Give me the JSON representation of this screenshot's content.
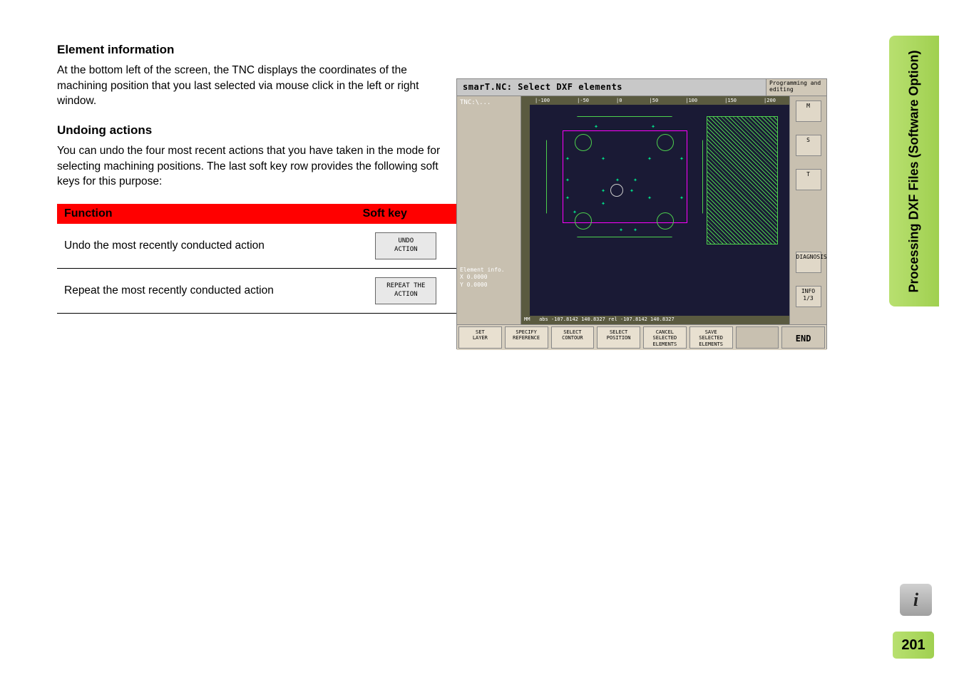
{
  "side_tab": "Processing DXF Files (Software Option)",
  "section1": {
    "heading": "Element information",
    "body": "At the bottom left of the screen, the TNC displays the coordinates of the machining position that you last selected via mouse click in the left or right window."
  },
  "section2": {
    "heading": "Undoing actions",
    "body": "You can undo the four most recent actions that you have taken in the mode for selecting machining positions. The last soft key row provides the following soft keys for this purpose:"
  },
  "table": {
    "head_func": "Function",
    "head_soft": "Soft key",
    "rows": [
      {
        "desc": "Undo the most recently conducted action",
        "key": "UNDO\nACTION"
      },
      {
        "desc": "Repeat the most recently conducted action",
        "key": "REPEAT THE\nACTION"
      }
    ]
  },
  "tnc": {
    "title": "smarT.NC: Select DXF elements",
    "mode": "Programming\nand editing",
    "path": "TNC:\\...",
    "ruler_ticks": [
      "|-100",
      "|-50",
      "|0",
      "|50",
      "|100",
      "|150",
      "|200"
    ],
    "elem_info_label": "Element info.",
    "elem_x": "X     0.0000",
    "elem_y": "Y     0.0000",
    "statusbar_unit": "MM",
    "statusbar_coords": "abs -107.8142 140.8327 rel -107.8142 140.8327",
    "side_icons": {
      "m": "M",
      "s": "S",
      "t": "T",
      "diag": "DIAGNOSIS",
      "info": "INFO 1/3"
    },
    "softkeys": [
      "SET\nLAYER",
      "SPECIFY\nREFERENCE",
      "SELECT\nCONTOUR",
      "SELECT\nPOSITION",
      "CANCEL\nSELECTED\nELEMENTS",
      "SAVE\nSELECTED\nELEMENTS",
      "",
      "END"
    ]
  },
  "page_number": "201",
  "info_icon": "i"
}
